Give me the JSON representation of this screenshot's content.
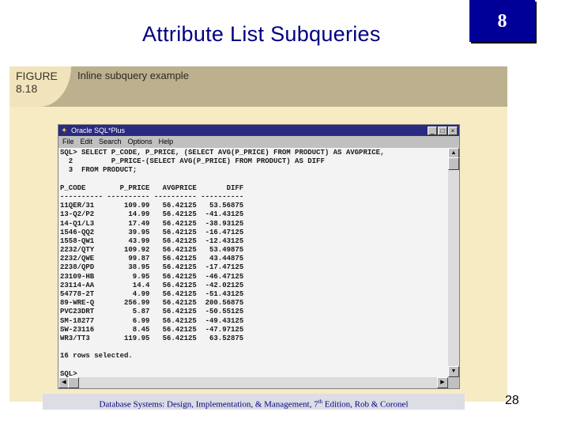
{
  "slide": {
    "title": "Attribute List Subqueries",
    "chapter": "8",
    "page_number": "28",
    "footer_pre": "Database Systems: Design, Implementation, & Management, 7",
    "footer_sup": "th",
    "footer_post": " Edition, Rob & Coronel"
  },
  "figure": {
    "label": "FIGURE",
    "number": "8.18",
    "caption": "Inline subquery example"
  },
  "window": {
    "title": "Oracle SQL*Plus",
    "menu": [
      "File",
      "Edit",
      "Search",
      "Options",
      "Help"
    ],
    "query": [
      "SQL> SELECT P_CODE, P_PRICE, (SELECT AVG(P_PRICE) FROM PRODUCT) AS AVGPRICE,",
      "  2         P_PRICE-(SELECT AVG(P_PRICE) FROM PRODUCT) AS DIFF",
      "  3  FROM PRODUCT;"
    ],
    "columns": [
      "P_CODE",
      "P_PRICE",
      "AVGPRICE",
      "DIFF"
    ],
    "rows": [
      [
        "11QER/31",
        "109.99",
        "56.42125",
        "53.56875"
      ],
      [
        "13-Q2/P2",
        "14.99",
        "56.42125",
        "-41.43125"
      ],
      [
        "14-Q1/L3",
        "17.49",
        "56.42125",
        "-38.93125"
      ],
      [
        "1546-QQ2",
        "39.95",
        "56.42125",
        "-16.47125"
      ],
      [
        "1558-QW1",
        "43.99",
        "56.42125",
        "-12.43125"
      ],
      [
        "2232/QTY",
        "109.92",
        "56.42125",
        "53.49875"
      ],
      [
        "2232/QWE",
        "99.87",
        "56.42125",
        "43.44875"
      ],
      [
        "2238/QPD",
        "38.95",
        "56.42125",
        "-17.47125"
      ],
      [
        "23109-HB",
        "9.95",
        "56.42125",
        "-46.47125"
      ],
      [
        "23114-AA",
        "14.4",
        "56.42125",
        "-42.02125"
      ],
      [
        "54778-2T",
        "4.99",
        "56.42125",
        "-51.43125"
      ],
      [
        "89-WRE-Q",
        "256.99",
        "56.42125",
        "200.56875"
      ],
      [
        "PVC23DRT",
        "5.87",
        "56.42125",
        "-50.55125"
      ],
      [
        "SM-18277",
        "6.99",
        "56.42125",
        "-49.43125"
      ],
      [
        "SW-23116",
        "8.45",
        "56.42125",
        "-47.97125"
      ],
      [
        "WR3/TT3",
        "119.95",
        "56.42125",
        "63.52875"
      ]
    ],
    "summary": "16 rows selected.",
    "prompt": "SQL>"
  }
}
